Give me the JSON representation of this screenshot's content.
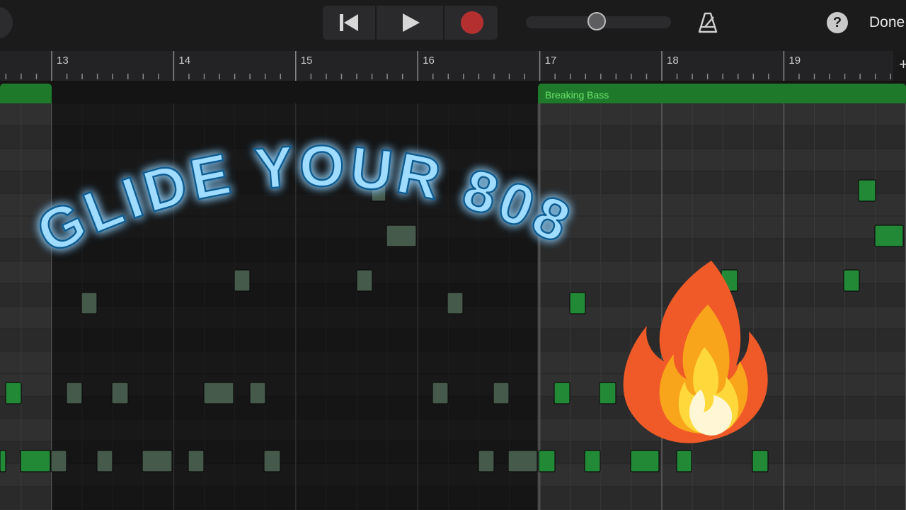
{
  "toolbar": {
    "transport": {
      "rewind_icon": "rewind-to-start-icon",
      "play_icon": "play-icon",
      "record_icon": "record-icon",
      "record_color": "#b43030"
    },
    "master_volume_level": 0.49,
    "metronome_icon": "metronome-icon",
    "help_label": "?",
    "done_label": "Done"
  },
  "ruler": {
    "bars": [
      "13",
      "14",
      "15",
      "16",
      "17",
      "18",
      "19"
    ]
  },
  "regions": [
    {
      "name": "",
      "color": "#1e7a2a"
    },
    {
      "name": "Breaking Bass",
      "color": "#1e7a2a"
    }
  ],
  "piano_roll": {
    "active_note_color": "#228a37",
    "inactive_note_color": "#465a4c"
  },
  "overlay": {
    "title": "GLIDE YOUR 808'S!!",
    "title_color": "#9fdcff",
    "emoji": "fire-emoji"
  }
}
